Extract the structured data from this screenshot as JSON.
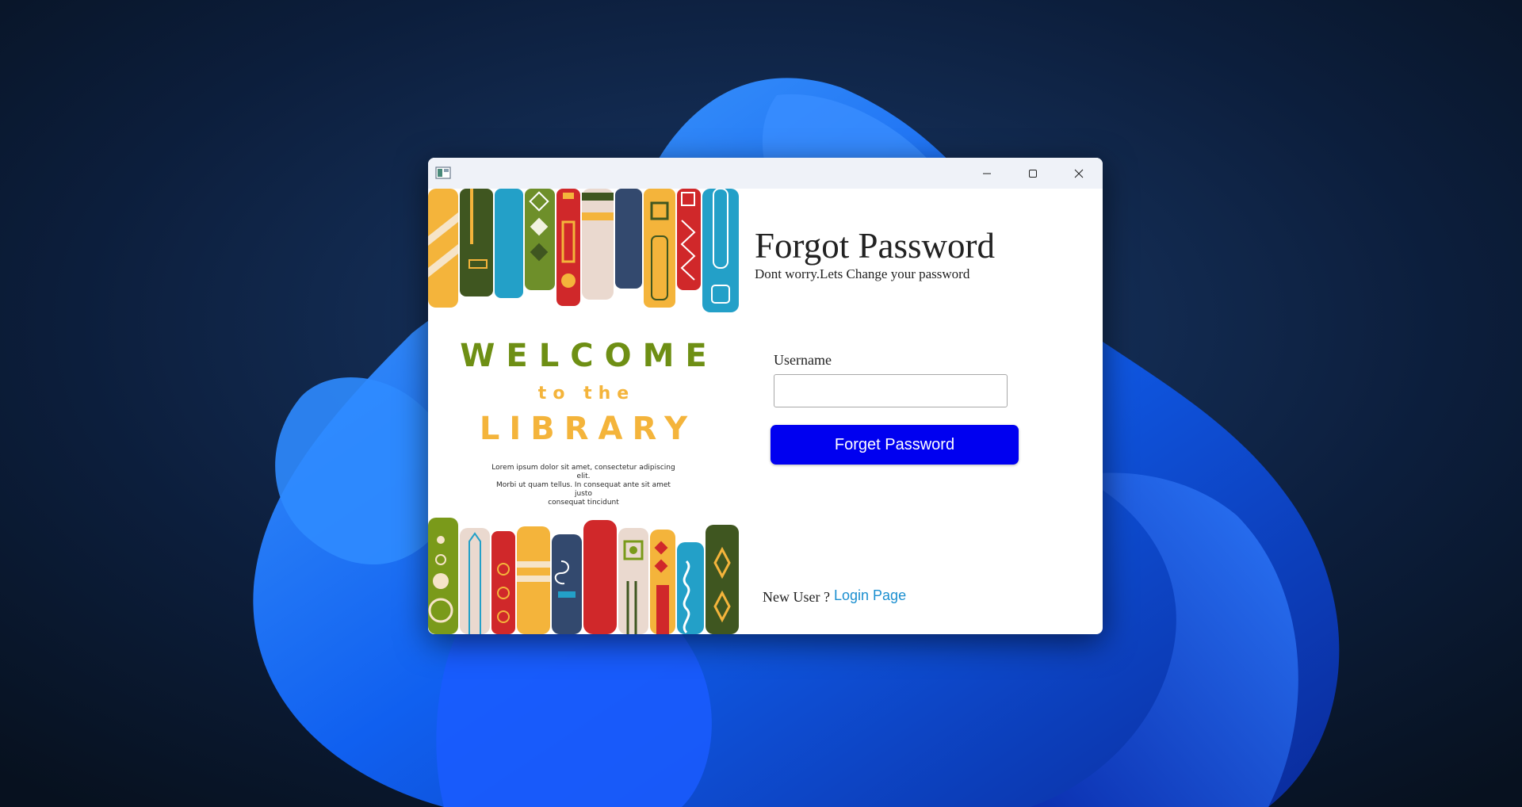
{
  "window": {
    "controls": {
      "minimize": "minimize-icon",
      "maximize": "maximize-icon",
      "close": "close-icon"
    }
  },
  "banner": {
    "welcome": "WELCOME",
    "to_the": "to the",
    "library": "LIBRARY",
    "lorem_lines": [
      "Lorem ipsum dolor sit amet, consectetur adipiscing elit.",
      "Morbi ut quam tellus. In consequat ante sit amet justo",
      "consequat tincidunt"
    ]
  },
  "form": {
    "title": "Forgot Password",
    "subtitle": "Dont worry.Lets Change your password",
    "username_label": "Username",
    "username_value": "",
    "submit_label": "Forget Password",
    "new_user_text": "New User ?",
    "login_link": "Login Page"
  },
  "colors": {
    "button": "#0000f0",
    "link": "#1b8fd0",
    "welcome": "#6e8f14",
    "library": "#f4b43b"
  }
}
